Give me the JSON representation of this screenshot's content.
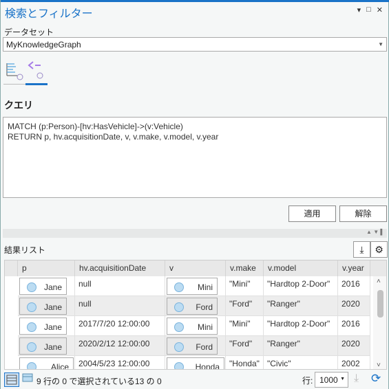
{
  "window": {
    "title": "検索とフィルター",
    "controls": [
      "▾",
      "□",
      "✕"
    ]
  },
  "dataset": {
    "label": "データセット",
    "value": "MyKnowledgeGraph"
  },
  "tabs": [
    {
      "icon": "list-search-icon",
      "selected": false
    },
    {
      "icon": "query-icon",
      "selected": true
    }
  ],
  "query": {
    "label": "クエリ",
    "text": "MATCH (p:Person)-[hv:HasVehicle]->(v:Vehicle)\nRETURN p, hv.acquisitionDate, v, v.make, v.model, v.year"
  },
  "buttons": {
    "apply": "適用",
    "clear": "解除"
  },
  "results": {
    "label": "結果リスト",
    "columns": [
      "p",
      "hv.acquisitionDate",
      "v",
      "v.make",
      "v.model",
      "v.year"
    ],
    "rows": [
      [
        "Jane",
        "null",
        "Mini",
        "\"Mini\"",
        "\"Hardtop 2-Door\"",
        "2016"
      ],
      [
        "Jane",
        "null",
        "Ford",
        "\"Ford\"",
        "\"Ranger\"",
        "2020"
      ],
      [
        "Jane",
        "2017/7/20   12:00:00",
        "Mini",
        "\"Mini\"",
        "\"Hardtop 2-Door\"",
        "2016"
      ],
      [
        "Jane",
        "2020/2/12   12:00:00",
        "Ford",
        "\"Ford\"",
        "\"Ranger\"",
        "2020"
      ],
      [
        "Alice",
        "2004/5/23   12:00:00",
        "Honda",
        "\"Honda\"",
        "\"Civic\"",
        "2002"
      ]
    ]
  },
  "footer": {
    "status": "9 行の 0 で選択されている13 の 0",
    "rows_label": "行:",
    "rows_value": "1000"
  },
  "colors": {
    "accent": "#1a73c8"
  }
}
